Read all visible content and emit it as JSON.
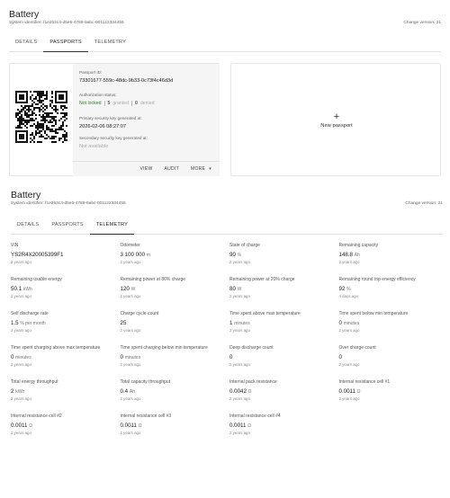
{
  "top": {
    "title": "Battery",
    "system_id": "System identifier: f1e2b3c4-d5e6-4789-9abc-001122334455",
    "change_version": "Change version: 21",
    "tabs": [
      {
        "label": "DETAILS"
      },
      {
        "label": "PASSPORTS",
        "active": true
      },
      {
        "label": "TELEMETRY"
      }
    ]
  },
  "passport_card": {
    "id_label": "Passport ID:",
    "id_value": "73301677-559c-48dc-9b33-0c73f4c46d3d",
    "auth_label": "Authorization status:",
    "auth_status": "Not locked",
    "granted_count": "5",
    "granted_label": "granted",
    "denied_count": "0",
    "denied_label": "denied",
    "primary_key_label": "Primary security key generated at:",
    "primary_key_value": "2026-02-06 08:27:07",
    "secondary_key_label": "Secondary security key generated at:",
    "secondary_key_value": "Not available",
    "actions": {
      "view": "VIEW",
      "audit": "AUDIT",
      "more": "MORE"
    }
  },
  "new_passport": {
    "plus": "+",
    "label": "New passport"
  },
  "bottom": {
    "title": "Battery",
    "system_id": "System identifier: f1e2b3c4-d5e6-4789-9abc-001122334455",
    "change_version": "Change version: 21",
    "tabs": [
      {
        "label": "DETAILS"
      },
      {
        "label": "PASSPORTS"
      },
      {
        "label": "TELEMETRY",
        "active": true
      }
    ]
  },
  "telemetry": [
    {
      "label": "VIN",
      "value": "YS2R4X20005399F1",
      "unit": "",
      "time": "2 years ago"
    },
    {
      "label": "Odometer",
      "value": "3 100 000",
      "unit": "m",
      "time": "2 years ago"
    },
    {
      "label": "State of charge",
      "value": "90",
      "unit": "%",
      "time": "2 years ago"
    },
    {
      "label": "Remaining capacity",
      "value": "148.8",
      "unit": "Ah",
      "time": "2 years ago"
    },
    {
      "label": "Remaining usable energy",
      "value": "50.1",
      "unit": "kWh",
      "time": "2 years ago"
    },
    {
      "label": "Remaining power at 80% charge",
      "value": "120",
      "unit": "W",
      "time": "2 years ago"
    },
    {
      "label": "Remaining power at 20% charge",
      "value": "80",
      "unit": "W",
      "time": "2 years ago"
    },
    {
      "label": "Remaining round trip energy efficiency",
      "value": "92",
      "unit": "%",
      "time": "4 days ago"
    },
    {
      "label": "Self discharge rate",
      "value": "1.5",
      "unit": "% per month",
      "time": "2 years ago"
    },
    {
      "label": "Charge cycle count",
      "value": "25",
      "unit": "",
      "time": "2 years ago"
    },
    {
      "label": "Time spent above max temperature",
      "value": "1",
      "unit": "minutes",
      "time": "2 years ago"
    },
    {
      "label": "Time spent below min temperature",
      "value": "0",
      "unit": "minutes",
      "time": "2 years ago"
    },
    {
      "label": "Time spent charging above max temperature",
      "value": "0",
      "unit": "minutes",
      "time": "2 years ago"
    },
    {
      "label": "Time spent charging below min temperature",
      "value": "0",
      "unit": "minutes",
      "time": "2 years ago"
    },
    {
      "label": "Deep discharge count",
      "value": "0",
      "unit": "",
      "time": "2 years ago"
    },
    {
      "label": "Over charge count",
      "value": "0",
      "unit": "",
      "time": "2 years ago"
    },
    {
      "label": "Total energy throughput",
      "value": "2",
      "unit": "kWh",
      "time": "2 years ago"
    },
    {
      "label": "Total capacity throughput",
      "value": "0.4",
      "unit": "Ah",
      "time": "2 years ago"
    },
    {
      "label": "Internal pack resistance",
      "value": "0.0042",
      "unit": "Ω",
      "time": "2 years ago"
    },
    {
      "label": "Internal resistance cell #1",
      "value": "0.0011",
      "unit": "Ω",
      "time": "2 years ago"
    },
    {
      "label": "Internal resistance cell #2",
      "value": "0.0011",
      "unit": "Ω",
      "time": "2 years ago"
    },
    {
      "label": "Internal resistance cell #3",
      "value": "0.0011",
      "unit": "Ω",
      "time": "2 years ago"
    },
    {
      "label": "Internal resistance cell #4",
      "value": "0.0011",
      "unit": "Ω",
      "time": "2 years ago"
    }
  ]
}
